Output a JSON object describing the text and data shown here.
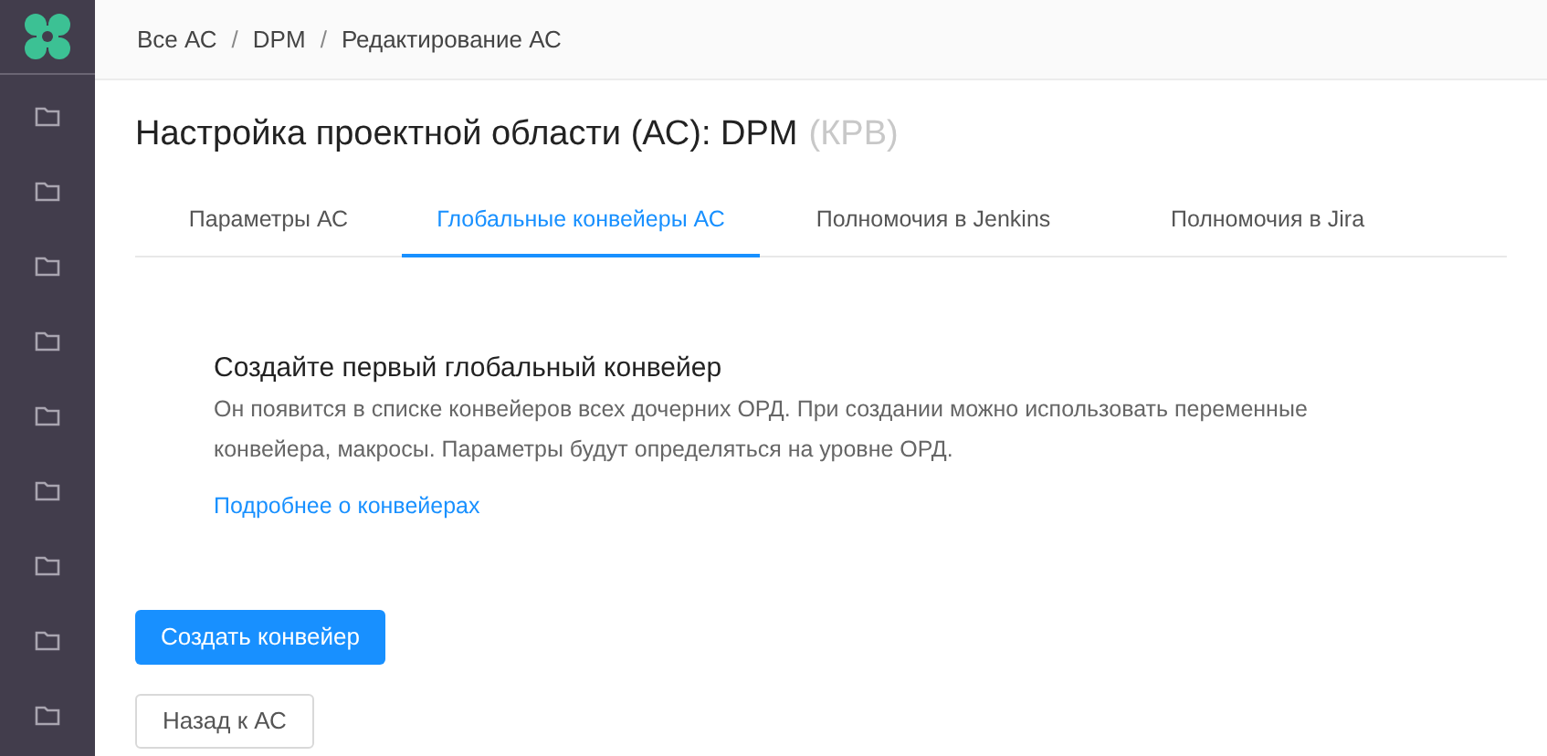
{
  "sidebar": {
    "items": [
      {
        "kind": "folder"
      },
      {
        "kind": "folder"
      },
      {
        "kind": "folder"
      },
      {
        "kind": "folder"
      },
      {
        "kind": "folder"
      },
      {
        "kind": "folder"
      },
      {
        "kind": "folder"
      },
      {
        "kind": "folder"
      },
      {
        "kind": "folder"
      }
    ]
  },
  "breadcrumb": [
    {
      "kind": "link",
      "text": "Все АС"
    },
    {
      "kind": "separator",
      "text": "/"
    },
    {
      "kind": "link",
      "text": "DPM"
    },
    {
      "kind": "separator",
      "text": "/"
    },
    {
      "kind": "current",
      "text": "Редактирование АС"
    }
  ],
  "page_title": {
    "text": "Настройка проектной области (АС): DPM",
    "code": "(КРВ)"
  },
  "tabs": [
    {
      "label": "Параметры АС",
      "selected": false
    },
    {
      "label": "Глобальные конвейеры АС",
      "selected": true
    },
    {
      "label": "Полномочия в Jenkins",
      "selected": false
    },
    {
      "label": "Полномочия в Jira",
      "selected": false
    }
  ],
  "empty_state": {
    "heading": "Создайте первый глобальный конвейер",
    "description": "Он появится в списке конвейеров всех дочерних ОРД. При создании можно использовать переменные конвейера, макросы. Параметры будут определяться на уровне ОРД.",
    "link": "Подробнее о конвейерах"
  },
  "buttons": [
    {
      "kind": "primary",
      "label": "Создать конвейер"
    },
    {
      "kind": "default",
      "label": "Назад к АС"
    }
  ]
}
